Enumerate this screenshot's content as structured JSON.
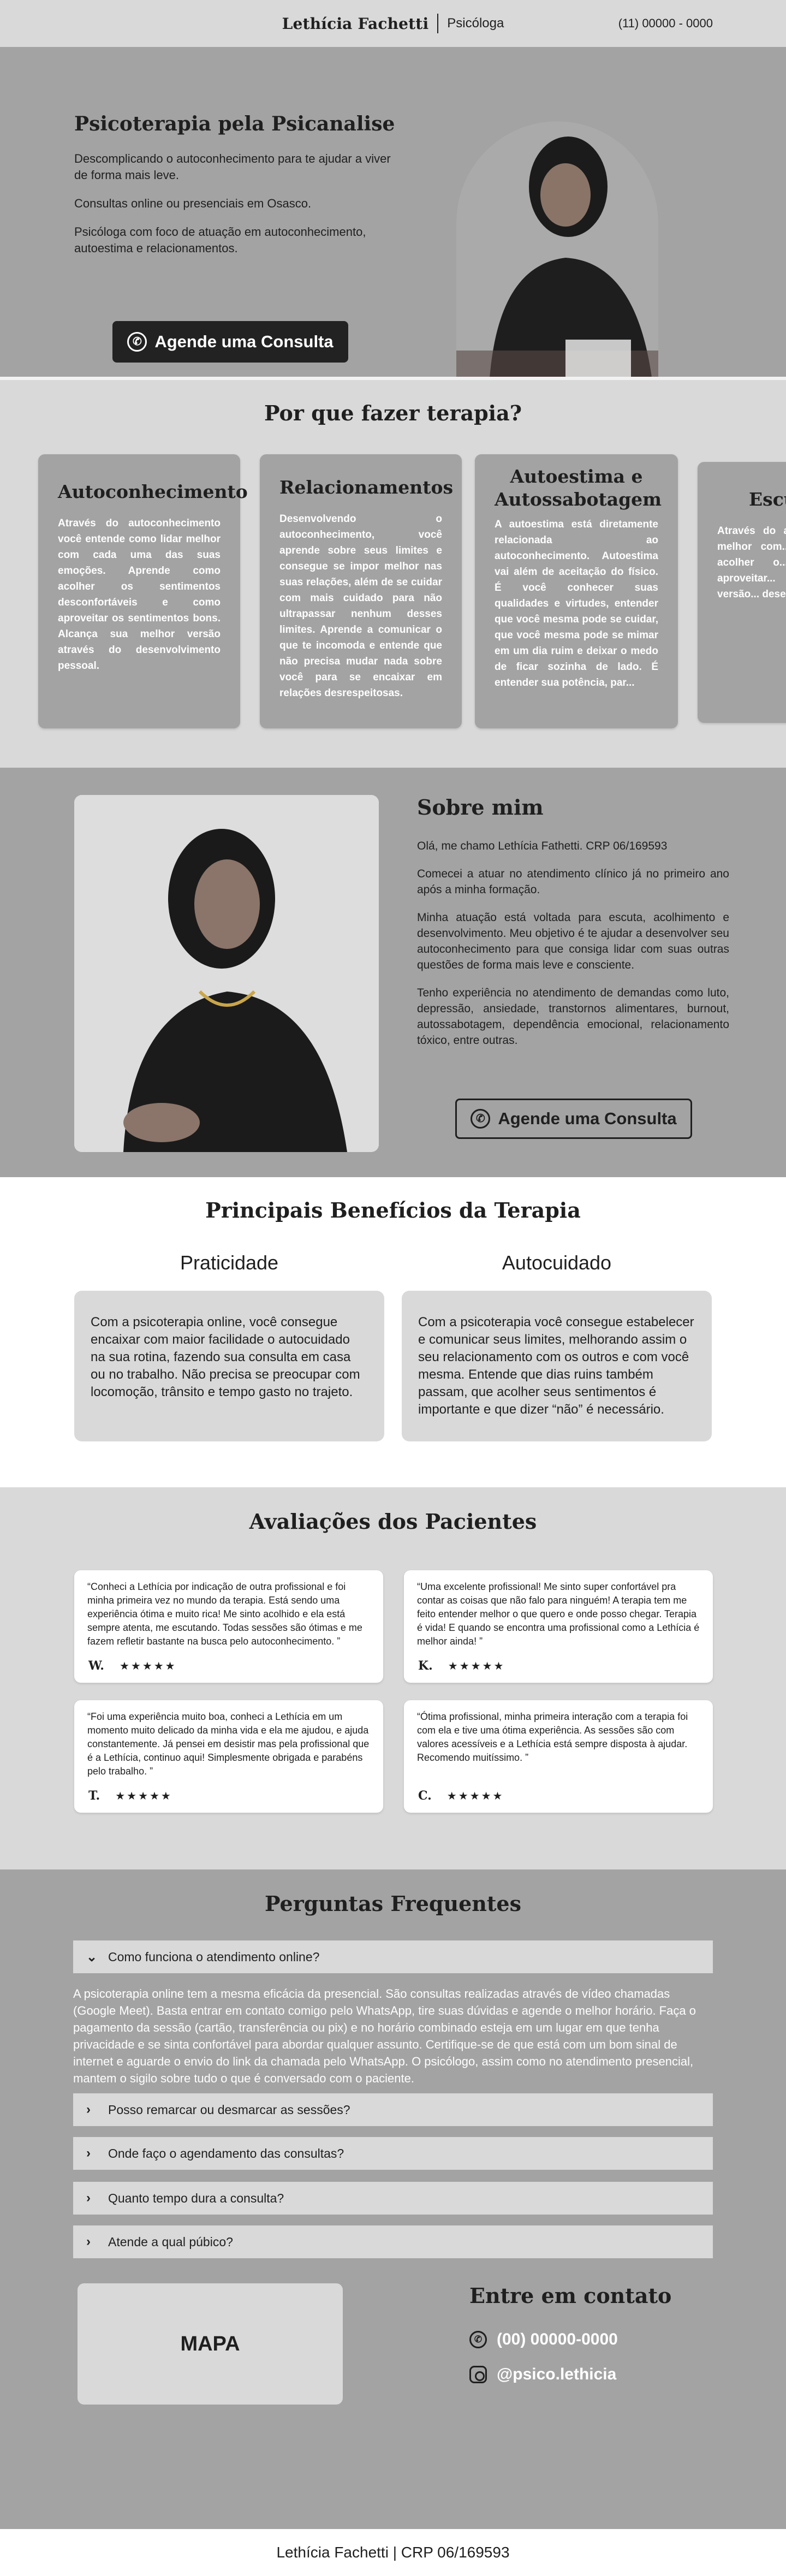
{
  "header": {
    "name": "Lethícia Fachetti",
    "role": "Psicóloga",
    "phone": "(11) 00000 - 0000"
  },
  "hero": {
    "title": "Psicoterapia pela Psicanalise",
    "p1": "Descomplicando o autoconhecimento para te ajudar a viver de forma mais leve.",
    "p2": "Consultas online ou presenciais em Osasco.",
    "p3": "Psicóloga com foco de atuação em autoconhecimento, autoestima e relacionamentos.",
    "cta": "Agende uma Consulta"
  },
  "why": {
    "title": "Por que fazer terapia?",
    "cards": [
      {
        "title": "Autoconhecimento",
        "text": "Através do autoconhecimento você entende como lidar melhor com cada uma das suas emoções. Aprende como acolher os sentimentos desconfortáveis e como aproveitar os sentimentos bons. Alcança sua melhor versão através do desenvolvimento pessoal."
      },
      {
        "title": "Relacionamentos",
        "text": "Desenvolvendo o autoconhecimento, você aprende sobre seus limites e consegue se impor melhor nas suas relações, além de se cuidar com mais cuidado para não ultrapassar nenhum desses limites. Aprende a comunicar o que te incomoda e entende que não precisa mudar nada sobre você para se encaixar em relações desrespeitosas."
      },
      {
        "title": "Autoestima e Autossabotagem",
        "text": "A autoestima está diretamente relacionada ao autoconhecimento. Autoestima vai além de aceitação do físico. É você conhecer suas qualidades e virtudes, entender que você mesma pode se cuidar, que você mesma pode se mimar em um dia ruim e deixar o medo de ficar sozinha de lado. É entender sua potência, par..."
      },
      {
        "title": "Escuta",
        "text": "Através do a... você entend... melhor com... suas emoçõe... acolher o... desconfortáv... aproveitar... bons. Alcanç... versão... desenvolvim..."
      }
    ]
  },
  "about": {
    "title": "Sobre mim",
    "p1": "Olá, me chamo Lethícia Fathetti. CRP 06/169593",
    "p2": "Comecei a atuar no atendimento clínico já no primeiro ano após a minha formação.",
    "p3": "Minha atuação está voltada para escuta, acolhimento e desenvolvimento. Meu objetivo é te ajudar a desenvolver seu autoconhecimento para que consiga lidar com suas outras questões de forma mais leve e consciente.",
    "p4": "Tenho experiência no atendimento de demandas como luto, depressão, ansiedade, transtornos alimentares, burnout, autossabotagem, dependência emocional, relacionamento tóxico, entre outras.",
    "cta": "Agende uma Consulta"
  },
  "benefits": {
    "title": "Principais Benefícios da Terapia",
    "items": [
      {
        "title": "Praticidade",
        "text": "Com a psicoterapia online, você consegue encaixar com maior facilidade o autocuidado na sua rotina, fazendo sua consulta em casa ou no trabalho. Não precisa se preocupar com locomoção, trânsito e tempo gasto no trajeto."
      },
      {
        "title": "Autocuidado",
        "text": "Com a psicoterapia você consegue estabelecer e comunicar seus limites, melhorando assim o seu relacionamento com os outros e com você mesma. Entende que dias ruins também passam, que acolher seus sentimentos é importante e que dizer “não” é necessário."
      }
    ]
  },
  "reviews": {
    "title": "Avaliações dos Pacientes",
    "items": [
      {
        "text": "“Conheci a Lethícia por indicação de outra profissional e foi minha primeira vez no mundo da terapia. Está sendo uma experiência ótima e muito rica! Me sinto acolhido e ela está sempre atenta, me escutando. Todas sessões são ótimas e me fazem refletir bastante na busca pelo autoconhecimento. ”",
        "name": "W.",
        "stars": "★★★★★"
      },
      {
        "text": "“Uma excelente profissional! Me sinto super confortável pra contar as coisas que não falo para ninguém! A terapia tem me feito entender melhor o que quero e onde posso chegar. Terapia é vida! E quando se encontra uma profissional como a Lethícia é melhor ainda! ”",
        "name": "K.",
        "stars": "★★★★★"
      },
      {
        "text": "“Foi uma experiência muito boa, conheci a Lethícia em um momento muito delicado da minha vida e ela me ajudou, e ajuda constantemente. Já pensei em desistir mas pela profissional que é a Lethícia, continuo aqui! Simplesmente obrigada e parabéns pelo trabalho. ”",
        "name": "T.",
        "stars": "★★★★★"
      },
      {
        "text": "“Ótima profissional, minha primeira interação com a terapia foi com ela e tive uma ótima experiência. As sessões são com valores acessíveis e a Lethícia está sempre disposta à ajudar. Recomendo muitíssimo. ”",
        "name": "C.",
        "stars": "★★★★★"
      }
    ]
  },
  "faq": {
    "title": "Perguntas Frequentes",
    "open_question": "Como funciona o atendimento online?",
    "answer": "A psicoterapia online tem a mesma eficácia da presencial. São consultas realizadas através de vídeo chamadas (Google Meet). Basta entrar em contato comigo pelo WhatsApp, tire suas dúvidas e agende o melhor horário. Faça o pagamento da sessão (cartão, transferência ou pix) e no horário combinado esteja em um lugar em que tenha privacidade e se sinta confortável para abordar qualquer assunto. Certifique-se de que está com um bom sinal de internet e aguarde o envio do link da chamada pelo WhatsApp. O psicólogo, assim como no atendimento presencial, mantem o sigilo sobre tudo o que é conversado com o paciente.",
    "q2": "Posso remarcar ou desmarcar as sessões?",
    "q3": "Onde faço o agendamento das consultas?",
    "q4": "Quanto tempo dura a consulta?",
    "q5": "Atende a qual púbico?"
  },
  "contact": {
    "map": "MAPA",
    "title": "Entre em contato",
    "phone": "(00) 00000-0000",
    "instagram": "@psico.lethicia"
  },
  "footer": {
    "text": "Lethícia Fachetti | CRP 06/169593"
  }
}
